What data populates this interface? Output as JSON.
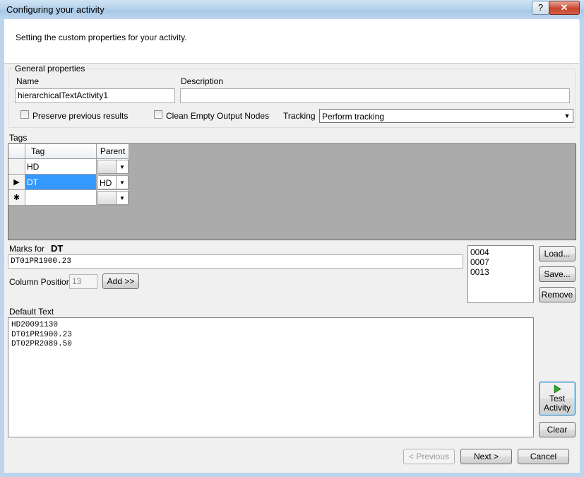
{
  "window": {
    "title": "Configuring your activity",
    "help_label": "?",
    "close_label": "✕"
  },
  "header": {
    "text": "Setting the custom properties for your activity."
  },
  "general": {
    "title": "General properties",
    "name_label": "Name",
    "name_value": "hierarchicalTextActivity1",
    "description_label": "Description",
    "description_value": "",
    "preserve_label": "Preserve previous results",
    "preserve_checked": false,
    "clean_label": "Clean Empty Output Nodes",
    "clean_checked": false,
    "tracking_label": "Tracking",
    "tracking_value": "Perform tracking"
  },
  "tags": {
    "title": "Tags",
    "columns": [
      "Tag",
      "Parent"
    ],
    "rows": [
      {
        "indicator": "",
        "tag": "HD",
        "parent": ""
      },
      {
        "indicator": "▶",
        "tag": "DT",
        "parent": "HD"
      },
      {
        "indicator": "✱",
        "tag": "",
        "parent": ""
      }
    ]
  },
  "marks": {
    "label": "Marks for",
    "tag": "DT",
    "sample": "DT01PR1900.23",
    "column_position_label": "Column Position",
    "column_position_value": "13",
    "add_label": "Add >>",
    "list": [
      "0004",
      "0007",
      "0013"
    ]
  },
  "side_buttons": {
    "load": "Load...",
    "save": "Save...",
    "remove": "Remove"
  },
  "default_text": {
    "label": "Default Text",
    "lines": [
      "HD20091130",
      "DT01PR1900.23",
      "DT02PR2089.50"
    ]
  },
  "test": {
    "line1": "Test",
    "line2": "Activity",
    "clear": "Clear"
  },
  "footer": {
    "previous": "< Previous",
    "next": "Next >",
    "cancel": "Cancel"
  }
}
